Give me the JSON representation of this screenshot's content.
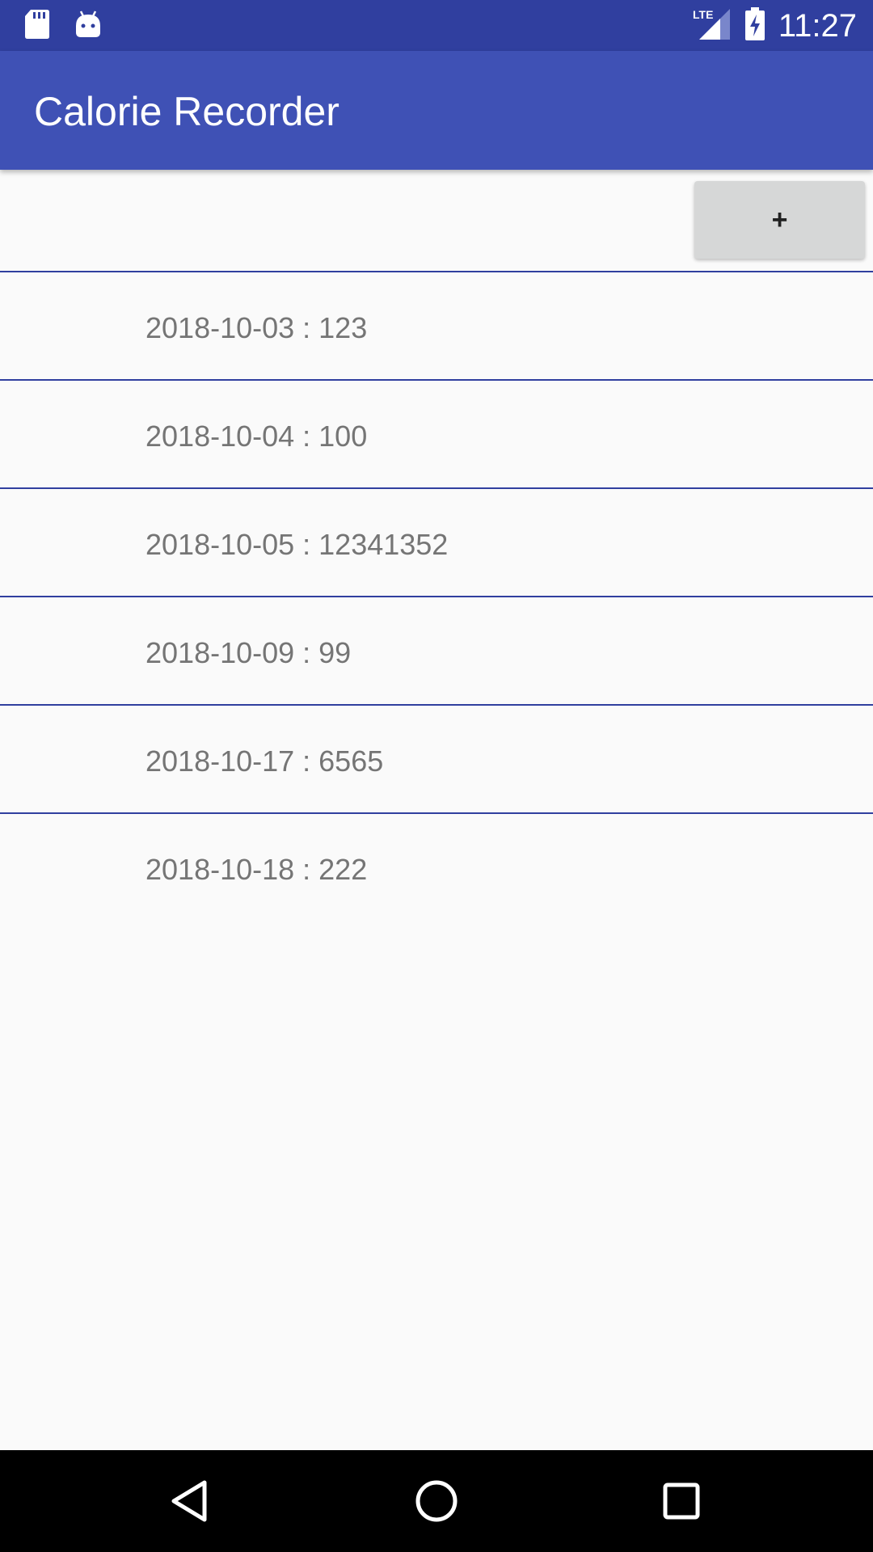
{
  "status_bar": {
    "time": "11:27",
    "network": "LTE",
    "left_icons": [
      "sd-card-icon",
      "android-icon"
    ],
    "right_icons": [
      "lte-signal-icon",
      "battery-charging-icon"
    ]
  },
  "app_bar": {
    "title": "Calorie Recorder"
  },
  "toolbar": {
    "add_label": "+"
  },
  "records": [
    {
      "text": "2018-10-03 : 123"
    },
    {
      "text": "2018-10-04 : 100"
    },
    {
      "text": "2018-10-05 : 12341352"
    },
    {
      "text": "2018-10-09 : 99"
    },
    {
      "text": "2018-10-17 : 6565"
    },
    {
      "text": "2018-10-18 : 222"
    }
  ],
  "nav_bar": {
    "icons": [
      "back-icon",
      "home-icon",
      "recents-icon"
    ]
  },
  "colors": {
    "status_bar": "#303f9f",
    "app_bar": "#3f51b5",
    "divider": "#303f9f",
    "background": "#fafafa",
    "item_text": "#757575",
    "button_bg": "#d6d7d7"
  }
}
